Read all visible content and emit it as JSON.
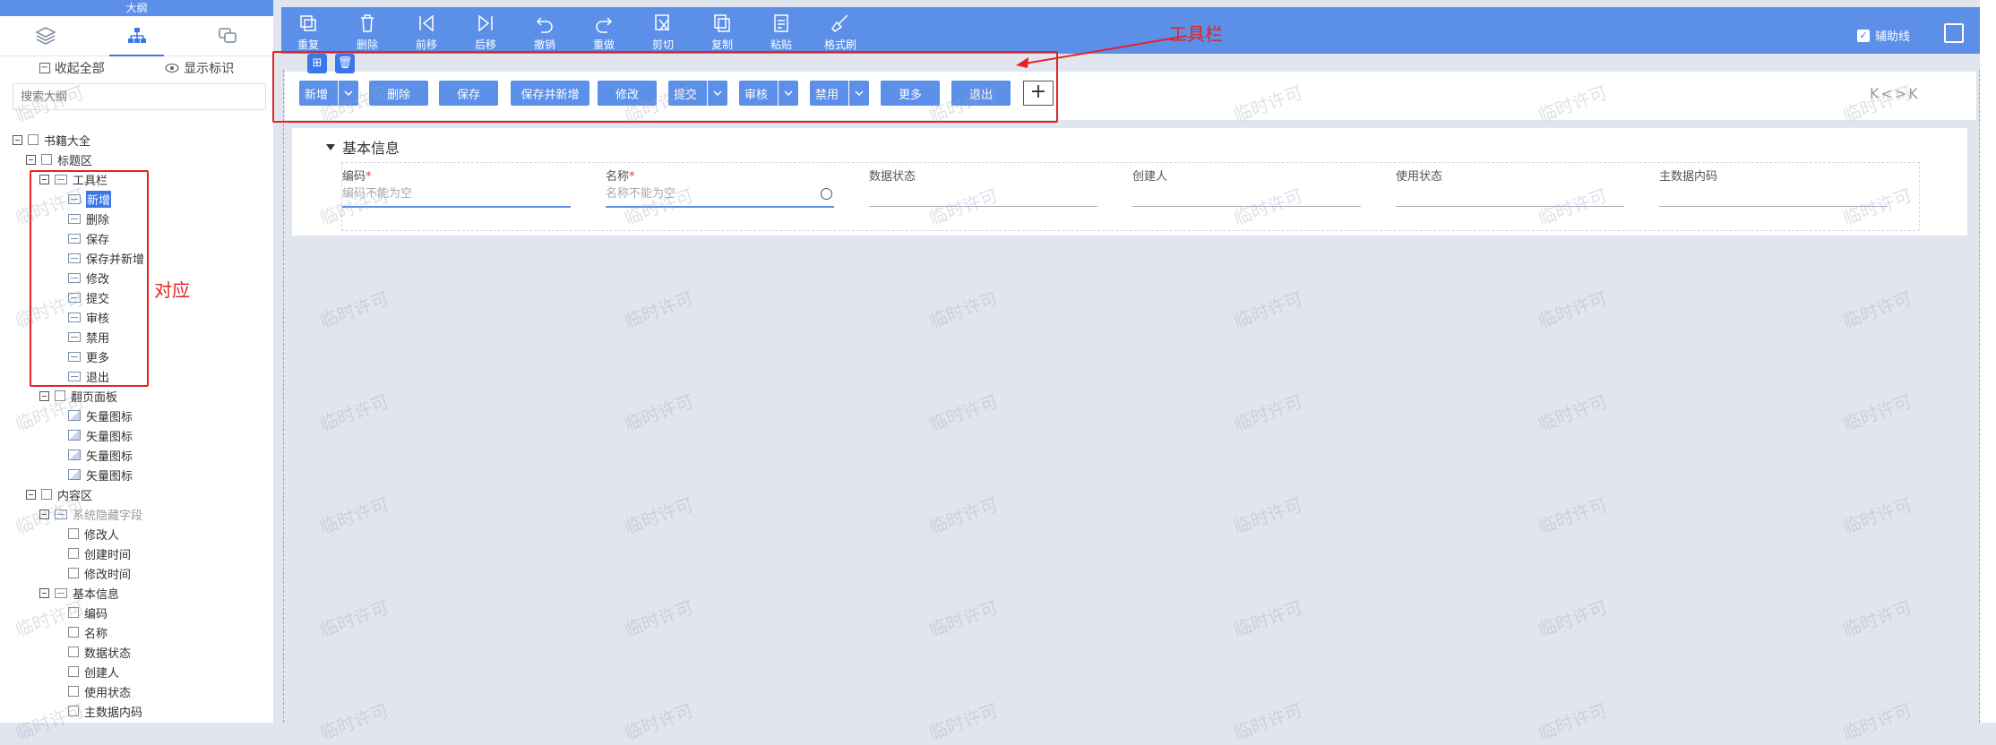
{
  "sidebar": {
    "title": "大纲",
    "actions": {
      "collapse_all": "收起全部",
      "show_marks": "显示标识"
    },
    "search_placeholder": "搜索大纲",
    "tree": [
      {
        "label": "书籍大全",
        "level": 0,
        "kind": "folder"
      },
      {
        "label": "标题区",
        "level": 1,
        "kind": "folder"
      },
      {
        "label": "工具栏",
        "level": 2,
        "kind": "group"
      },
      {
        "label": "新增",
        "level": 3,
        "kind": "item",
        "selected": true
      },
      {
        "label": "删除",
        "level": 3,
        "kind": "item"
      },
      {
        "label": "保存",
        "level": 3,
        "kind": "item"
      },
      {
        "label": "保存并新增",
        "level": 3,
        "kind": "item"
      },
      {
        "label": "修改",
        "level": 3,
        "kind": "item"
      },
      {
        "label": "提交",
        "level": 3,
        "kind": "item"
      },
      {
        "label": "审核",
        "level": 3,
        "kind": "item"
      },
      {
        "label": "禁用",
        "level": 3,
        "kind": "item"
      },
      {
        "label": "更多",
        "level": 3,
        "kind": "item"
      },
      {
        "label": "退出",
        "level": 3,
        "kind": "item"
      },
      {
        "label": "翻页面板",
        "level": 2,
        "kind": "folder"
      },
      {
        "label": "矢量图标",
        "level": 3,
        "kind": "img"
      },
      {
        "label": "矢量图标",
        "level": 3,
        "kind": "img"
      },
      {
        "label": "矢量图标",
        "level": 3,
        "kind": "img"
      },
      {
        "label": "矢量图标",
        "level": 3,
        "kind": "img"
      },
      {
        "label": "内容区",
        "level": 1,
        "kind": "folder"
      },
      {
        "label": "系统隐藏字段",
        "level": 2,
        "kind": "group",
        "dim": true
      },
      {
        "label": "修改人",
        "level": 3,
        "kind": "field"
      },
      {
        "label": "创建时间",
        "level": 3,
        "kind": "field"
      },
      {
        "label": "修改时间",
        "level": 3,
        "kind": "field"
      },
      {
        "label": "基本信息",
        "level": 2,
        "kind": "group"
      },
      {
        "label": "编码",
        "level": 3,
        "kind": "field"
      },
      {
        "label": "名称",
        "level": 3,
        "kind": "field"
      },
      {
        "label": "数据状态",
        "level": 3,
        "kind": "field"
      },
      {
        "label": "创建人",
        "level": 3,
        "kind": "field"
      },
      {
        "label": "使用状态",
        "level": 3,
        "kind": "field"
      },
      {
        "label": "主数据内码",
        "level": 3,
        "kind": "field"
      }
    ]
  },
  "topbar": {
    "tools": [
      "重复",
      "删除",
      "前移",
      "后移",
      "撤销",
      "重做",
      "剪切",
      "复制",
      "粘贴",
      "格式刷"
    ],
    "assist_label": "辅助线"
  },
  "toolbar_buttons": [
    {
      "label": "新增",
      "split": true
    },
    {
      "label": "删除",
      "split": false
    },
    {
      "label": "保存",
      "split": false
    },
    {
      "label": "保存并新增",
      "split": false
    },
    {
      "label": "修改",
      "split": false
    },
    {
      "label": "提交",
      "split": true
    },
    {
      "label": "审核",
      "split": true
    },
    {
      "label": "禁用",
      "split": true
    },
    {
      "label": "更多",
      "split": false
    },
    {
      "label": "退出",
      "split": false
    }
  ],
  "pager_glyphs": "K<>K",
  "form": {
    "section_title": "基本信息",
    "fields": [
      {
        "label": "编码",
        "required": true,
        "placeholder": "编码不能为空"
      },
      {
        "label": "名称",
        "required": true,
        "placeholder": "名称不能为空"
      },
      {
        "label": "数据状态",
        "required": false,
        "placeholder": ""
      },
      {
        "label": "创建人",
        "required": false,
        "placeholder": ""
      },
      {
        "label": "使用状态",
        "required": false,
        "placeholder": ""
      },
      {
        "label": "主数据内码",
        "required": false,
        "placeholder": ""
      }
    ]
  },
  "annotations": {
    "toolbar": "工具栏",
    "correspond": "对应"
  },
  "watermark": "临时许可",
  "colors": {
    "primary": "#5b8fe8",
    "selected": "#3b78e7",
    "annotation": "#e42323"
  }
}
